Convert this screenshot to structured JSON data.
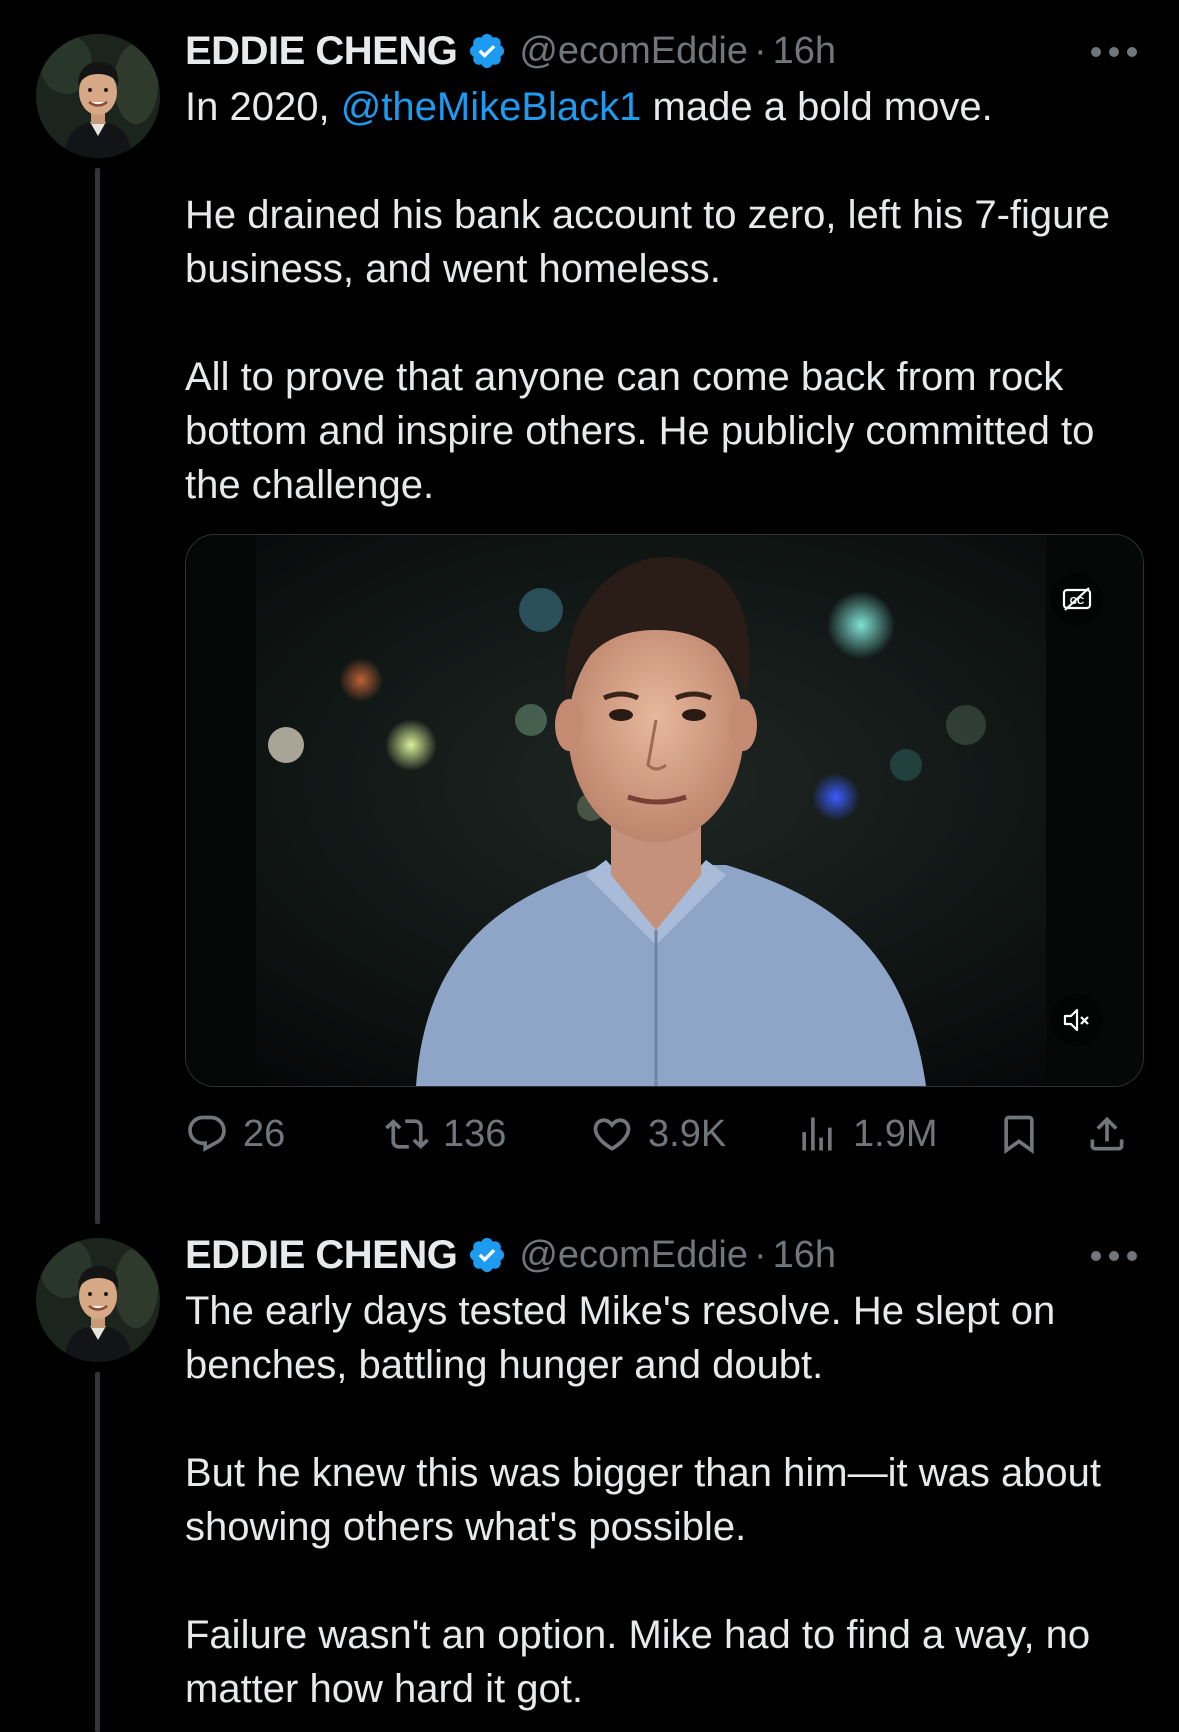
{
  "tweets": [
    {
      "author_name": "EDDIE CHENG",
      "handle": "@ecomEddie",
      "separator": "·",
      "time": "16h",
      "text_intro": "In 2020, ",
      "mention": "@theMikeBlack1",
      "text_intro_rest": " made a bold move.",
      "paragraphs": [
        "He drained his bank account to zero, left his 7-figure business, and went homeless.",
        "All to prove that anyone can come back from rock bottom and inspire others. He publicly committed to the challenge."
      ],
      "media": {
        "type": "video",
        "icons": [
          "captions-off-icon",
          "volume-muted-icon"
        ]
      },
      "actions": {
        "replies": "26",
        "reposts": "136",
        "likes": "3.9K",
        "views": "1.9M"
      }
    },
    {
      "author_name": "EDDIE CHENG",
      "handle": "@ecomEddie",
      "separator": "·",
      "time": "16h",
      "paragraphs": [
        "The early days tested Mike's resolve. He slept on benches, battling hunger and doubt.",
        "But he knew this was bigger than him—it was about showing others what's possible.",
        "Failure wasn't an option. Mike had to find a way, no matter how hard it got."
      ]
    }
  ],
  "colors": {
    "background": "#000000",
    "text": "#e7e9ea",
    "muted": "#71767b",
    "link": "#1d9bf0",
    "verified": "#1d9bf0",
    "thread_line": "#333639"
  }
}
